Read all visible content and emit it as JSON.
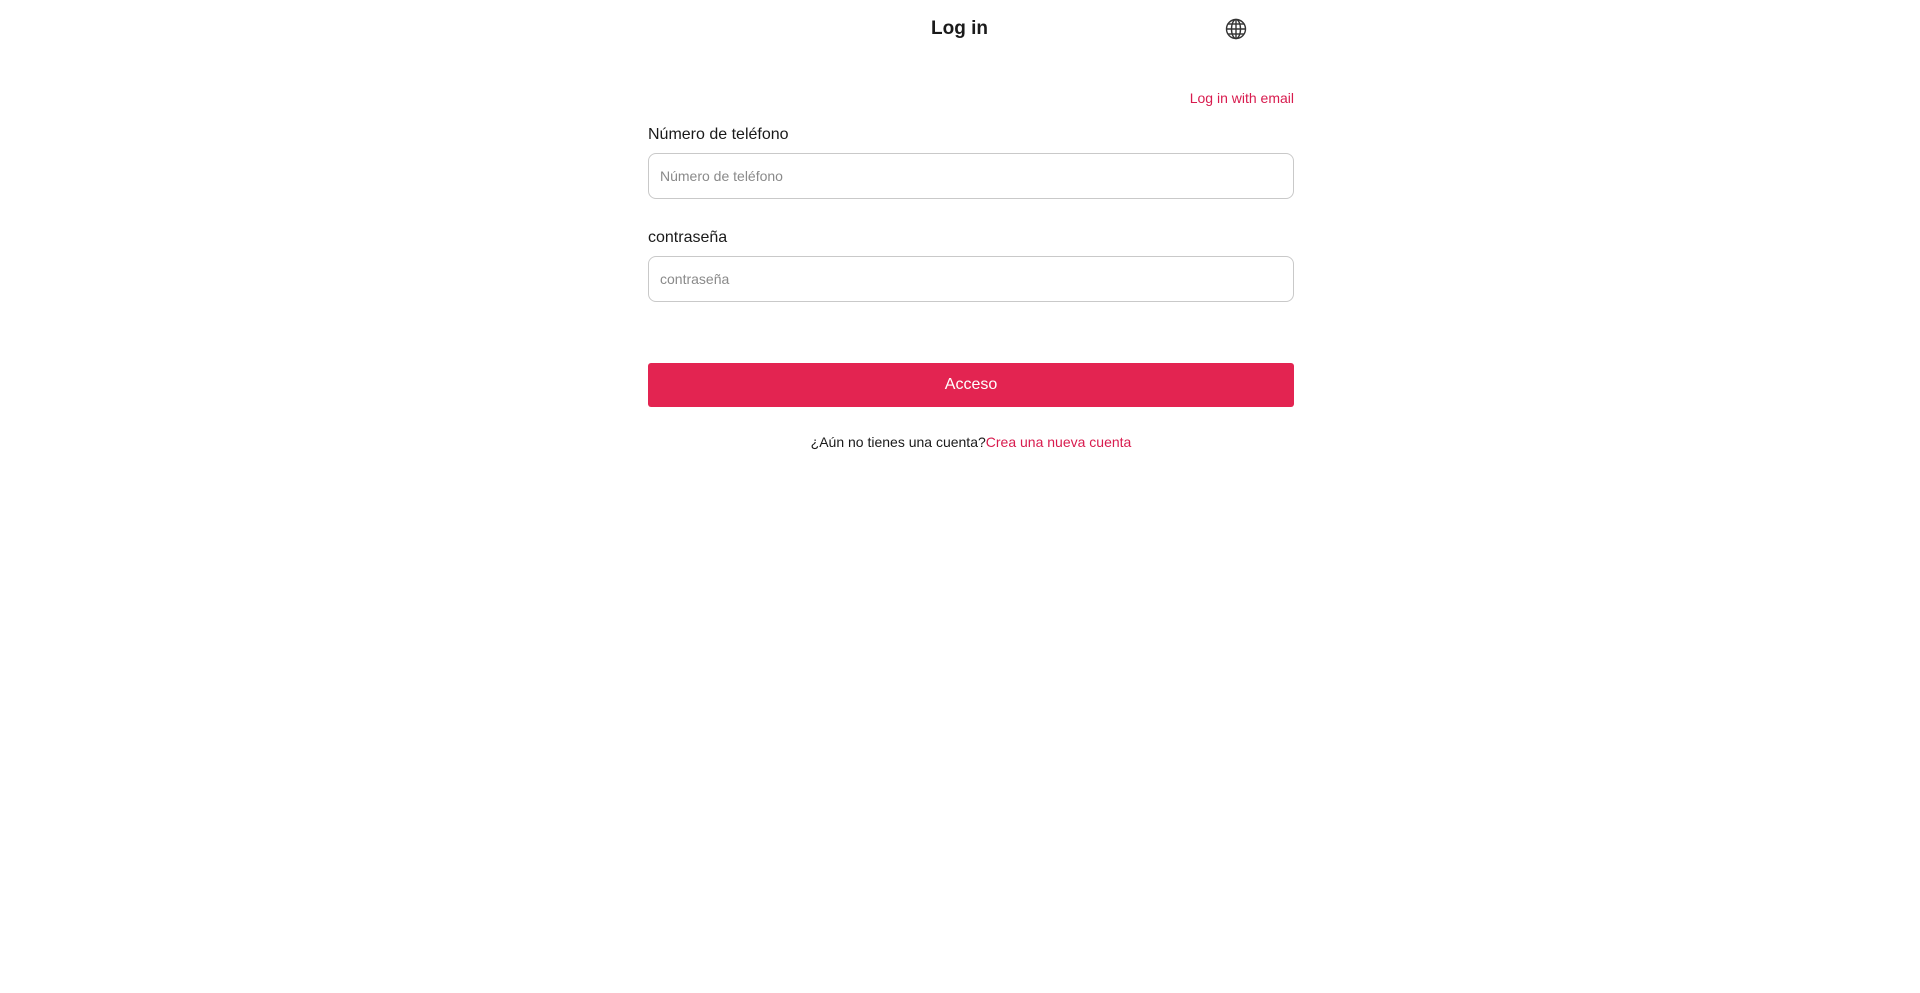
{
  "header": {
    "title": "Log in",
    "language_icon": "globe-icon"
  },
  "login": {
    "switch_link": "Log in with email",
    "phone": {
      "label": "Número de teléfono",
      "placeholder": "Número de teléfono",
      "value": ""
    },
    "password": {
      "label": "contraseña",
      "placeholder": "contraseña",
      "value": ""
    },
    "submit_label": "Acceso",
    "signup_prompt": "¿Aún no tienes una cuenta?",
    "signup_link": "Crea una nueva cuenta"
  },
  "colors": {
    "accent": "#e32451",
    "link": "#d81b4e",
    "input_border": "#c9c9c9",
    "text": "#1a1a1a"
  }
}
